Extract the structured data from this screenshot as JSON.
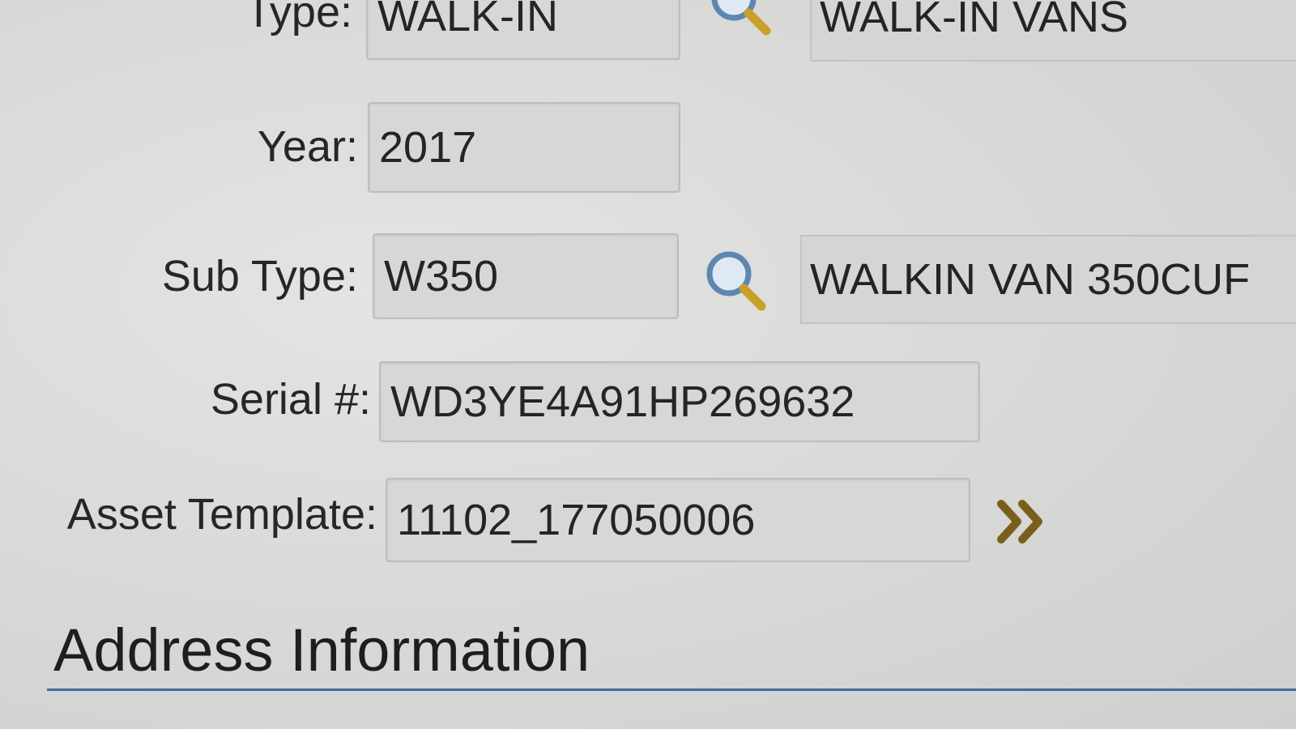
{
  "fields": {
    "type": {
      "label": "Type:",
      "value": "WALK-IN",
      "description": "WALK-IN VANS"
    },
    "year": {
      "label": "Year:",
      "value": "2017"
    },
    "sub_type": {
      "label": "Sub Type:",
      "value": "W350",
      "description": "WALKIN VAN 350CUF"
    },
    "serial": {
      "label": "Serial #:",
      "value": "WD3YE4A91HP269632"
    },
    "asset_template": {
      "label": "Asset Template:",
      "value": "11102_177050006"
    }
  },
  "sections": {
    "address": {
      "title": "Address Information"
    }
  },
  "icons": {
    "lookup": "magnifying-glass-icon",
    "expand": "double-chevron-right-icon"
  },
  "colors": {
    "section_rule": "#3a6f9a",
    "expand_icon": "#7a5f1c",
    "lookup_lens": "#5d87b0",
    "lookup_handle": "#c9a12a"
  }
}
